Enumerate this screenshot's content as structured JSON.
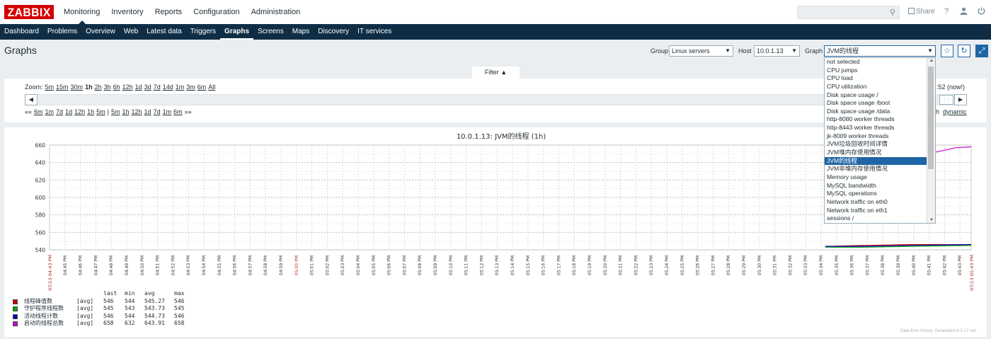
{
  "logo": "ZABBIX",
  "topnav": [
    "Monitoring",
    "Inventory",
    "Reports",
    "Configuration",
    "Administration"
  ],
  "topright": {
    "share": "Share",
    "help": "?",
    "user": "user-icon",
    "logout": "power-icon"
  },
  "subnav": [
    "Dashboard",
    "Problems",
    "Overview",
    "Web",
    "Latest data",
    "Triggers",
    "Graphs",
    "Screens",
    "Maps",
    "Discovery",
    "IT services"
  ],
  "page": {
    "title": "Graphs"
  },
  "filters": {
    "group_label": "Group",
    "group_value": "Linux servers",
    "host_label": "Host",
    "host_value": "10.0.1.13",
    "graph_label": "Graph",
    "graph_value": "JVM的线程"
  },
  "graph_options": [
    "not selected",
    "CPU jumps",
    "CPU load",
    "CPU utilization",
    "Disk space usage /",
    "Disk space usage /boot",
    "Disk space usage /data",
    "http-8080 worker threads",
    "http-8443 worker threads",
    "jk-8009 worker threads",
    "JVM垃圾回收时间详情",
    "JVM堆内存使用情况",
    "JVM的线程",
    "JVM非堆内存使用情况",
    "Memory usage",
    "MySQL bandwidth",
    "MySQL operations",
    "Network traffic on eth0",
    "Network traffic on eth1",
    "sessions /"
  ],
  "graph_selected_index": 12,
  "filter_tab": "Filter ▲",
  "zoom": {
    "label": "Zoom:",
    "options": [
      "5m",
      "15m",
      "30m",
      "1h",
      "2h",
      "3h",
      "6h",
      "12h",
      "1d",
      "3d",
      "7d",
      "14d",
      "1m",
      "3m",
      "6m",
      "All"
    ],
    "current": "1h"
  },
  "period_nav": {
    "back_prefix": "««",
    "back": [
      "6m",
      "1m",
      "7d",
      "1d",
      "12h",
      "1h",
      "5m"
    ],
    "separator": "|",
    "forward": [
      "5m",
      "1h",
      "12h",
      "1d",
      "7d",
      "1m",
      "6m"
    ],
    "forward_suffix": "»»"
  },
  "time_now": ":52 (now!)",
  "dynamic": {
    "prefix": "h",
    "label": "dynamic"
  },
  "colors": {
    "red": "#cc0000",
    "green": "#00aa00",
    "blue": "#0000bb",
    "purple": "#cc00cc"
  },
  "chart_data": {
    "type": "line",
    "title": "10.0.1.13: JVM的线程  (1h)",
    "ylim": [
      540,
      660
    ],
    "yticks": [
      540,
      560,
      580,
      600,
      620,
      640,
      660
    ],
    "x_start_label": "07/13 04:43 PM",
    "x_end_label": "07/13 05:43 PM",
    "x_ticks": [
      "04:45 PM",
      "04:46 PM",
      "04:47 PM",
      "04:48 PM",
      "04:49 PM",
      "04:50 PM",
      "04:51 PM",
      "04:52 PM",
      "04:53 PM",
      "04:54 PM",
      "04:55 PM",
      "04:56 PM",
      "04:57 PM",
      "04:58 PM",
      "04:59 PM",
      "05:00 PM",
      "05:01 PM",
      "05:02 PM",
      "05:03 PM",
      "05:04 PM",
      "05:05 PM",
      "05:06 PM",
      "05:07 PM",
      "05:08 PM",
      "05:09 PM",
      "05:10 PM",
      "05:11 PM",
      "05:12 PM",
      "05:13 PM",
      "05:14 PM",
      "05:15 PM",
      "05:16 PM",
      "05:17 PM",
      "05:18 PM",
      "05:19 PM",
      "05:20 PM",
      "05:21 PM",
      "05:22 PM",
      "05:23 PM",
      "05:24 PM",
      "05:25 PM",
      "05:26 PM",
      "05:27 PM",
      "05:28 PM",
      "05:29 PM",
      "05:30 PM",
      "05:31 PM",
      "05:32 PM",
      "05:33 PM",
      "05:34 PM",
      "05:35 PM",
      "05:36 PM",
      "05:37 PM",
      "05:38 PM",
      "05:39 PM",
      "05:40 PM",
      "05:41 PM",
      "05:42 PM",
      "05:43 PM"
    ],
    "x_highlight": "05:00 PM",
    "series": [
      {
        "name": "线程峰值数",
        "color": "#cc0000",
        "x": [
          50.5,
          53,
          56,
          60
        ],
        "y": [
          544,
          545,
          546,
          546
        ]
      },
      {
        "name": "守护程序线程数",
        "color": "#00aa00",
        "x": [
          50.5,
          53,
          56,
          60
        ],
        "y": [
          543,
          543,
          544,
          545
        ]
      },
      {
        "name": "活动线程计数",
        "color": "#0000bb",
        "x": [
          50.5,
          53,
          56,
          60
        ],
        "y": [
          544,
          544,
          545,
          546
        ]
      },
      {
        "name": "启动的线程总数",
        "color": "#cc00cc",
        "x": [
          50.5,
          52,
          54,
          56,
          58,
          59,
          60
        ],
        "y": [
          632,
          636,
          640,
          646,
          653,
          657,
          658
        ]
      }
    ]
  },
  "legend": {
    "headers": [
      "last",
      "min",
      "avg",
      "max"
    ],
    "rows": [
      {
        "name": "线程峰值数",
        "func": "[avg]",
        "last": "546",
        "min": "544",
        "avg": "545.27",
        "max": "546",
        "color": "#cc0000"
      },
      {
        "name": "守护程序线程数",
        "func": "[avg]",
        "last": "545",
        "min": "543",
        "avg": "543.73",
        "max": "545",
        "color": "#00aa00"
      },
      {
        "name": "活动线程计数",
        "func": "[avg]",
        "last": "546",
        "min": "544",
        "avg": "544.73",
        "max": "546",
        "color": "#0000bb"
      },
      {
        "name": "启动的线程总数",
        "func": "[avg]",
        "last": "658",
        "min": "632",
        "avg": "643.91",
        "max": "658",
        "color": "#cc00cc"
      }
    ]
  },
  "footer_note": "Data from history. Generated in 0.17 sec"
}
